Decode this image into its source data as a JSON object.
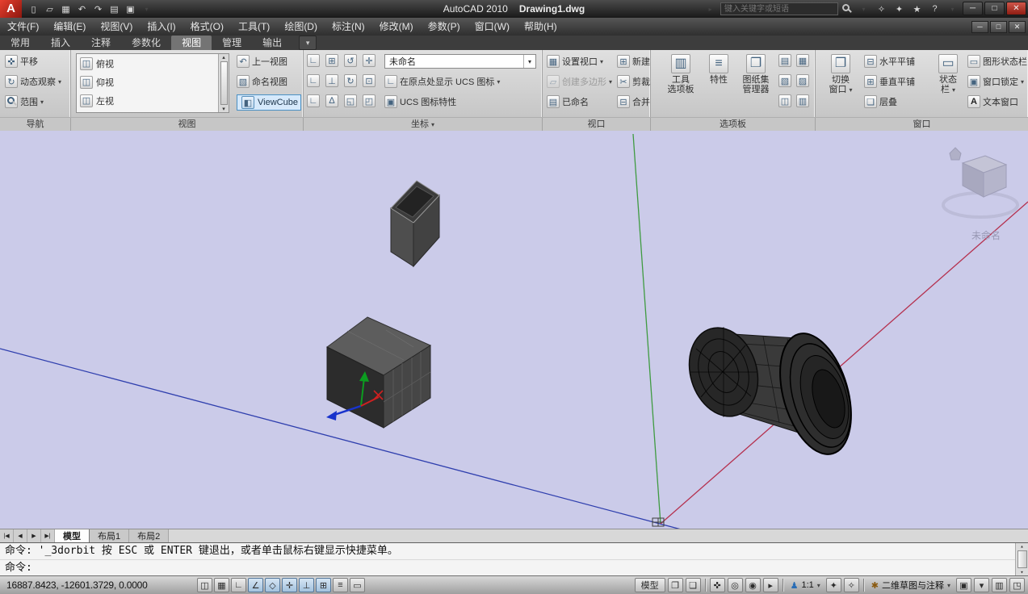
{
  "glyphs": {
    "logo": "A",
    "new_file": "▯",
    "open_folder": "▱",
    "save": "▦",
    "undo": "↶",
    "redo": "↷",
    "print": "▤",
    "plot": "▣",
    "caret_down": "▾",
    "caret_up": "▴",
    "caret_right": "▸",
    "subscription": "✧",
    "comm": "✦",
    "star": "★",
    "help": "?",
    "minimize": "─",
    "maximize": "□",
    "close": "✕",
    "pan": "✜",
    "orbit": "↻",
    "view_item": "◫",
    "prev_view": "↶",
    "named_view": "▧",
    "viewcube": "◧",
    "show_ucs": "∟",
    "ucs_props": "▣",
    "vp_set": "▦",
    "vp_new": "⊞",
    "vp_poly": "▱",
    "vp_clip": "✂",
    "vp_named": "▤",
    "vp_join": "⊟",
    "pal_tools": "▥",
    "pal_props": "≡",
    "pal_sheet": "❐",
    "win_switch": "❐",
    "win_htile": "⊟",
    "win_vtile": "⊞",
    "win_cascade": "❏",
    "win_status": "▭",
    "win_dstatus": "▭",
    "win_lock": "▣",
    "win_text": "A",
    "nav_first": "|◀",
    "nav_prev": "◀",
    "nav_next": "▶",
    "nav_last": "▶|",
    "st_qvl": "❐",
    "st_qvd": "❏",
    "st_pan": "✜",
    "st_zoom": "◎",
    "st_wheel": "◉",
    "st_motion": "▸",
    "st_person": "♟",
    "st_ann_vis": "✦",
    "st_ann_auto": "✧",
    "st_gear": "✱",
    "st_lock": "▣",
    "st_monitor": "▥",
    "st_screen": "◳",
    "st_tray": "▾"
  },
  "titlebar": {
    "app_title": "AutoCAD 2010",
    "doc_title": "Drawing1.dwg",
    "search_placeholder": "键入关键字或短语"
  },
  "menubar": {
    "items": [
      "文件(F)",
      "编辑(E)",
      "视图(V)",
      "插入(I)",
      "格式(O)",
      "工具(T)",
      "绘图(D)",
      "标注(N)",
      "修改(M)",
      "参数(P)",
      "窗口(W)",
      "帮助(H)"
    ]
  },
  "ribbon": {
    "tabs": [
      "常用",
      "插入",
      "注释",
      "参数化",
      "视图",
      "管理",
      "输出"
    ],
    "active_tab": "视图",
    "panel_labels": [
      "导航",
      "视图",
      "坐标",
      "视口",
      "选项板",
      "窗口"
    ],
    "nav": {
      "pan": "平移",
      "orbit": "动态观察",
      "extents": "范围"
    },
    "views": {
      "list": [
        "俯视",
        "仰视",
        "左视"
      ],
      "prev": "上一视图",
      "named": "命名视图",
      "viewcube": "ViewCube"
    },
    "coords": {
      "grid": [
        "∟",
        "⊞",
        "↺",
        "✛",
        "∟",
        "⊥",
        "↻",
        "⊡",
        "∟",
        "∆",
        "◱",
        "◰"
      ],
      "dropdown": "未命名",
      "show_ucs": "在原点处显示 UCS 图标",
      "props": "UCS 图标特性"
    },
    "viewports": {
      "set": "设置视口",
      "new": "新建",
      "polygon": "创建多边形",
      "clip": "剪裁",
      "named": "已命名",
      "join": "合并"
    },
    "palettes": {
      "tools1": "工具",
      "tools2": "选项板",
      "props": "特性",
      "sheet1": "图纸集",
      "sheet2": "管理器",
      "grid": [
        "▤",
        "▦",
        "▧",
        "▨",
        "◫",
        "▥"
      ]
    },
    "window": {
      "switch1": "切换",
      "switch2": "窗口",
      "htile": "水平平铺",
      "vtile": "垂直平铺",
      "cascade": "层叠",
      "status1": "状态",
      "status2": "栏",
      "dstatus": "图形状态栏",
      "lock": "窗口锁定",
      "text": "文本窗口"
    }
  },
  "canvas": {
    "viewcube_label": "未命名"
  },
  "layout": {
    "tabs": [
      "模型",
      "布局1",
      "布局2"
    ],
    "active": "模型"
  },
  "command": {
    "line1": "命令: '_3dorbit 按 ESC 或 ENTER 键退出，或者单击鼠标右键显示快捷菜单。",
    "line2": "命令:"
  },
  "statusbar": {
    "coordinates": "16887.8423, -12601.3729,  0.0000",
    "toggles": [
      "◫",
      "▦",
      "∟",
      "∠",
      "◇",
      "✛",
      "⊥",
      "⊞",
      "≡",
      "▭"
    ],
    "model": "模型",
    "scale": "1:1",
    "workspace": "二维草图与注释"
  }
}
